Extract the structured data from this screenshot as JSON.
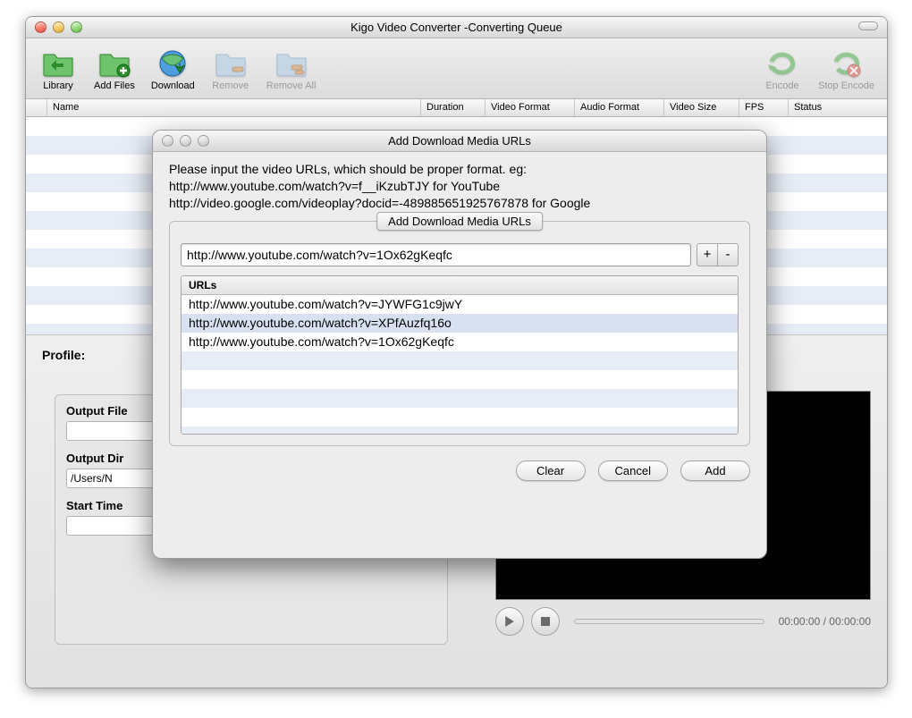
{
  "window": {
    "title": "Kigo Video Converter -Converting Queue"
  },
  "toolbar": {
    "library": "Library",
    "add_files": "Add Files",
    "download": "Download",
    "remove": "Remove",
    "remove_all": "Remove All",
    "encode": "Encode",
    "stop_encode": "Stop Encode"
  },
  "table": {
    "headers": {
      "name": "Name",
      "duration": "Duration",
      "video_format": "Video Format",
      "audio_format": "Audio Format",
      "video_size": "Video Size",
      "fps": "FPS",
      "status": "Status"
    }
  },
  "lower": {
    "profile_label": "Profile:",
    "output_file_label": "Output File",
    "output_file_value": "",
    "output_dir_label": "Output Dir",
    "output_dir_value": "/Users/N",
    "start_time_label": "Start Time",
    "start_time_value": "",
    "preview_time": "00:00:00 / 00:00:00"
  },
  "dialog": {
    "title": "Add Download Media URLs",
    "desc_line1": "Please input the video URLs, which should be proper format. eg:",
    "desc_line2": "http://www.youtube.com/watch?v=f__iKzubTJY  for YouTube",
    "desc_line3": "http://video.google.com/videoplay?docid=-489885651925767878 for Google",
    "legend": "Add Download Media URLs",
    "url_input": "http://www.youtube.com/watch?v=1Ox62gKeqfc",
    "plus": "+",
    "minus": "-",
    "list_header": "URLs",
    "urls": [
      "http://www.youtube.com/watch?v=JYWFG1c9jwY",
      "http://www.youtube.com/watch?v=XPfAuzfq16o",
      "http://www.youtube.com/watch?v=1Ox62gKeqfc"
    ],
    "clear_btn": "Clear",
    "cancel_btn": "Cancel",
    "add_btn": "Add"
  }
}
